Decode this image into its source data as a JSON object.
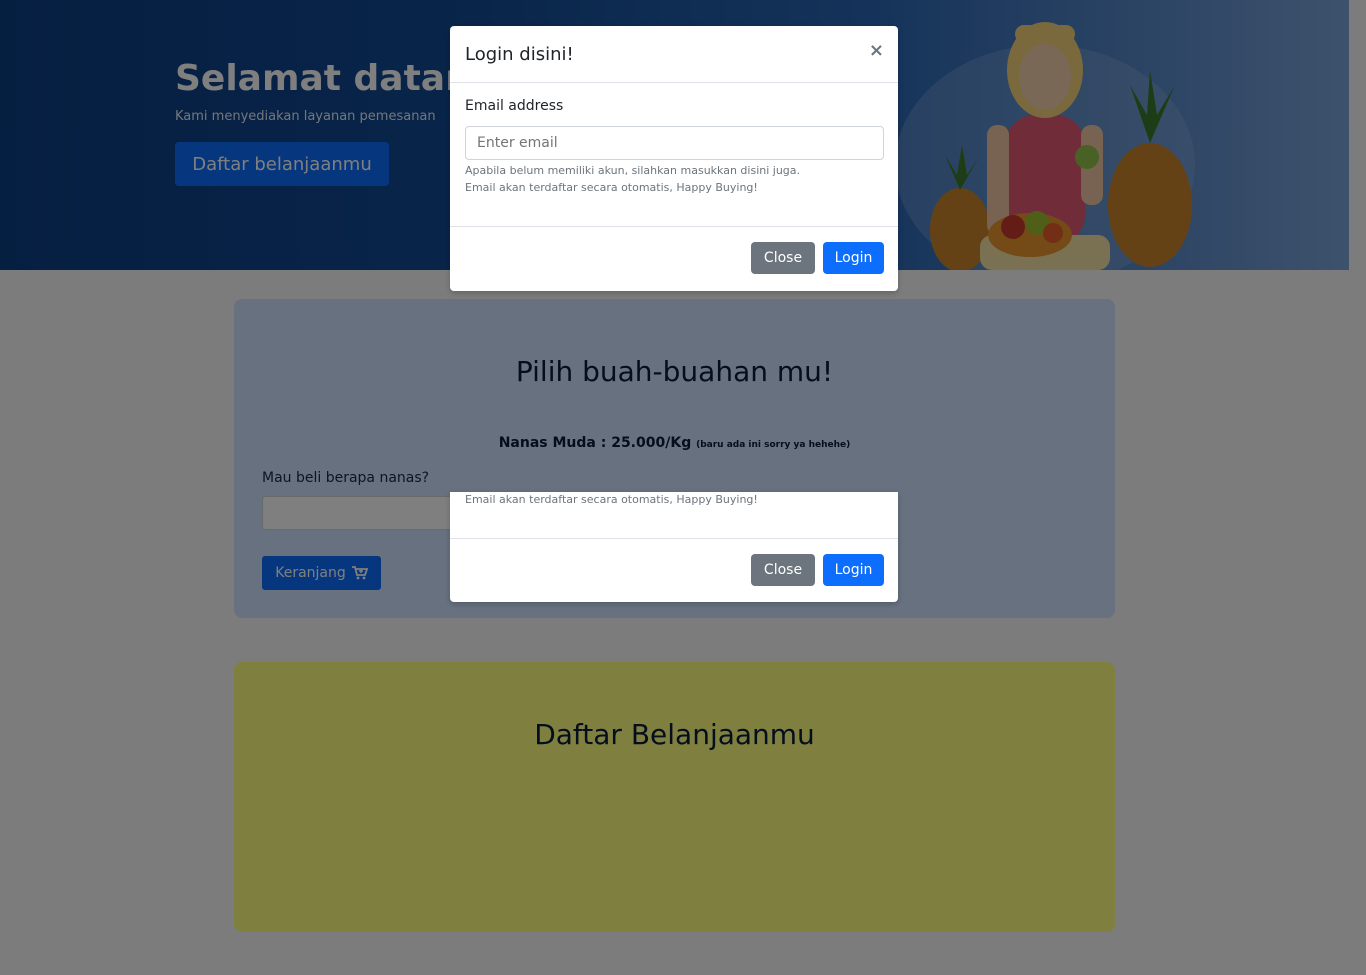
{
  "hero": {
    "title": "Selamat datang",
    "subtitle": "Kami menyediakan layanan pemesanan",
    "button_label": "Daftar belanjaanmu"
  },
  "pick_section": {
    "title": "Pilih buah-buahan mu!",
    "price_text": "Nanas Muda : 25.000/Kg",
    "price_note": "(baru ada ini sorry ya hehehe)",
    "quantity_label": "Mau beli berapa nanas?",
    "quantity_value": "",
    "cart_button_label": "Keranjang",
    "cart_icon": "cart-plus-icon"
  },
  "list_section": {
    "title": "Daftar Belanjaanmu"
  },
  "login_modal": {
    "title": "Login disini!",
    "close_symbol": "×",
    "email_label": "Email address",
    "email_placeholder": "Enter email",
    "help_line_1": "Apabila belum memiliki akun, silahkan masukkan disini juga.",
    "help_line_2": "Email akan terdaftar secara otomatis, Happy Buying!",
    "close_button_label": "Close",
    "login_button_label": "Login"
  },
  "ghost_modal": {
    "help_text": "Email akan terdaftar secara otomatis, Happy Buying!",
    "close_button_label": "Close",
    "login_button_label": "Login"
  },
  "colors": {
    "primary": "#0d6efd",
    "secondary": "#6c757d",
    "pick_bg": "#cfe2ff",
    "list_bg": "#ffff80",
    "hero_bg": "#124a94"
  }
}
